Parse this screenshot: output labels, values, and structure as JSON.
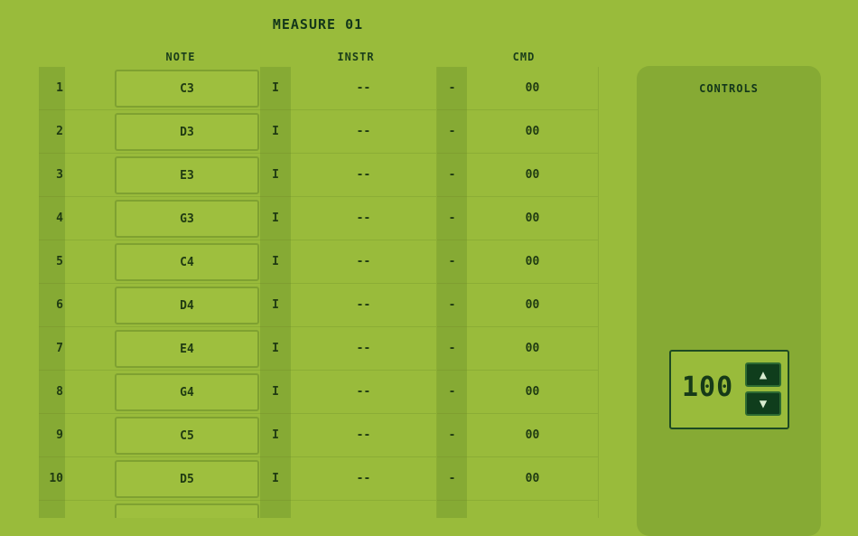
{
  "measure_title": "MEASURE 01",
  "headers": {
    "note": "NOTE",
    "instr": "INSTR",
    "cmd": "CMD"
  },
  "rows": [
    {
      "num": "1",
      "note": "C3",
      "ins": "I",
      "instr": "--",
      "sep": "-",
      "cmd": "00"
    },
    {
      "num": "2",
      "note": "D3",
      "ins": "I",
      "instr": "--",
      "sep": "-",
      "cmd": "00"
    },
    {
      "num": "3",
      "note": "E3",
      "ins": "I",
      "instr": "--",
      "sep": "-",
      "cmd": "00"
    },
    {
      "num": "4",
      "note": "G3",
      "ins": "I",
      "instr": "--",
      "sep": "-",
      "cmd": "00"
    },
    {
      "num": "5",
      "note": "C4",
      "ins": "I",
      "instr": "--",
      "sep": "-",
      "cmd": "00"
    },
    {
      "num": "6",
      "note": "D4",
      "ins": "I",
      "instr": "--",
      "sep": "-",
      "cmd": "00"
    },
    {
      "num": "7",
      "note": "E4",
      "ins": "I",
      "instr": "--",
      "sep": "-",
      "cmd": "00"
    },
    {
      "num": "8",
      "note": "G4",
      "ins": "I",
      "instr": "--",
      "sep": "-",
      "cmd": "00"
    },
    {
      "num": "9",
      "note": "C5",
      "ins": "I",
      "instr": "--",
      "sep": "-",
      "cmd": "00"
    },
    {
      "num": "10",
      "note": "D5",
      "ins": "I",
      "instr": "--",
      "sep": "-",
      "cmd": "00"
    },
    {
      "num": "",
      "note": "",
      "ins": "",
      "instr": "",
      "sep": "",
      "cmd": ""
    }
  ],
  "controls": {
    "title": "CONTROLS",
    "tempo_value": "100",
    "up_icon": "triangle-up-icon",
    "down_icon": "triangle-down-icon"
  },
  "colors": {
    "background": "#99bb3b",
    "panel": "#86aa34",
    "dark_button": "#0f3d1c"
  }
}
